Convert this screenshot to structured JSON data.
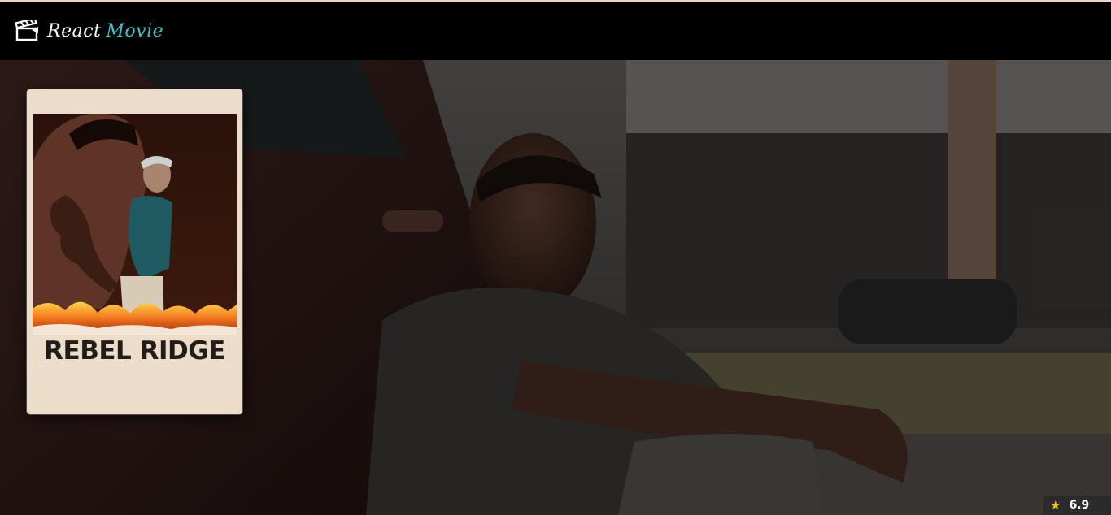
{
  "navbar": {
    "brand_part1": "React",
    "brand_part2": "Movie",
    "icon": "clapperboard-icon"
  },
  "movie": {
    "poster_title": "REBEL RIDGE",
    "rating": "6.9",
    "rating_icon": "star-icon"
  },
  "colors": {
    "navbar": "#000000",
    "brand_accent": "#3fc5c9",
    "rating_star": "#f2c21b",
    "top_stripe": "#f2d7c8"
  }
}
